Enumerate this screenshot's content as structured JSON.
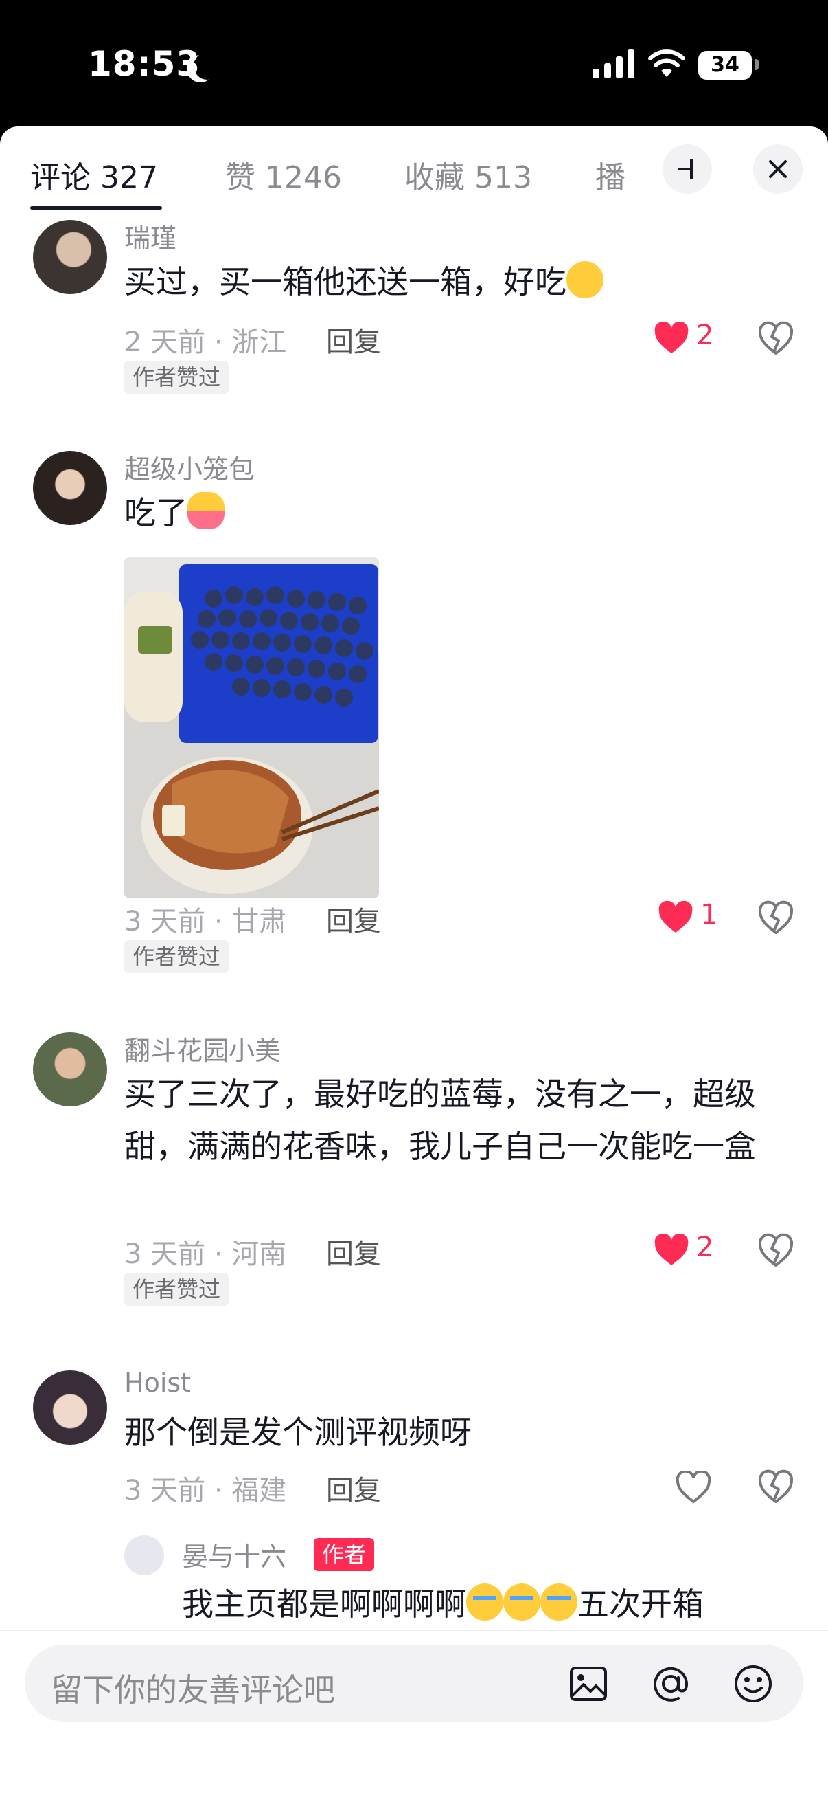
{
  "status_bar": {
    "time": "18:53",
    "battery": "34"
  },
  "tabs": [
    {
      "label": "评论 327"
    },
    {
      "label": "赞 1246"
    },
    {
      "label": "收藏 513"
    },
    {
      "label": "播"
    }
  ],
  "comments": [
    {
      "username": "瑞瑾",
      "text": "买过，买一箱他还送一箱，好吃",
      "emoji": "yum-emoji",
      "meta": "2 天前 · 浙江",
      "reply": "回复",
      "like_count": "2",
      "liked": true,
      "badge": "作者赞过"
    },
    {
      "username": "超级小笼包",
      "text": "吃了",
      "emoji": "hug-emoji",
      "meta": "3 天前 · 甘肃",
      "reply": "回复",
      "like_count": "1",
      "liked": true,
      "badge": "作者赞过"
    },
    {
      "username": "翻斗花园小美",
      "text": "买了三次了，最好吃的蓝莓，没有之一，超级甜，满满的花香味，我儿子自己一次能吃一盒",
      "meta": "3 天前 · 河南",
      "reply": "回复",
      "like_count": "2",
      "liked": true,
      "badge": "作者赞过"
    },
    {
      "username": "Hoist",
      "text": "那个倒是发个测评视频呀",
      "meta": "3 天前 · 福建",
      "reply": "回复",
      "liked": false
    }
  ],
  "sub_reply": {
    "username": "晏与十六",
    "author_tag": "作者",
    "text_before": "我主页都是啊啊啊啊",
    "text_after": "五次开箱"
  },
  "input": {
    "placeholder": "留下你的友善评论吧"
  },
  "colors": {
    "accent": "#fe2c55",
    "text": "#161823",
    "secondary": "#8a8b91"
  }
}
